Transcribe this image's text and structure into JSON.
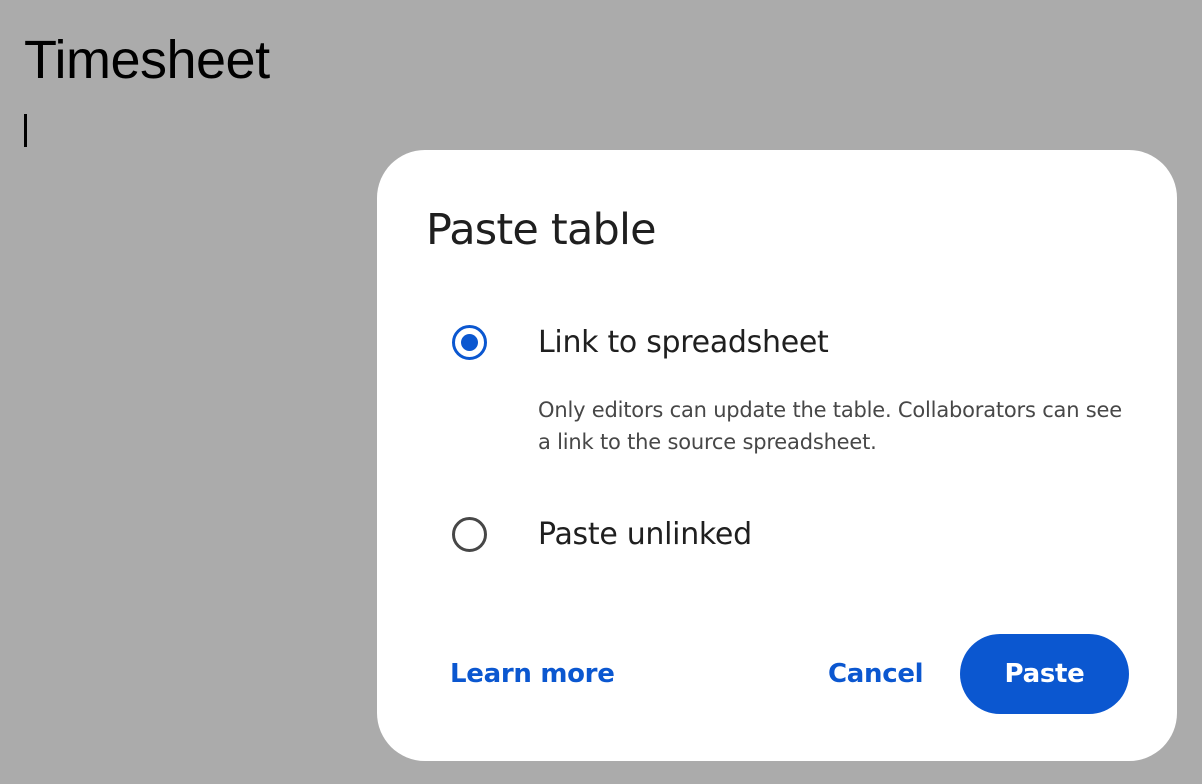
{
  "document": {
    "title": "Timesheet"
  },
  "dialog": {
    "title": "Paste table",
    "options": [
      {
        "label": "Link to spreadsheet",
        "checked": true,
        "description": "Only editors can update the table. Collaborators can see a link to the source spreadsheet."
      },
      {
        "label": "Paste unlinked",
        "checked": false
      }
    ],
    "learn_more_label": "Learn more",
    "cancel_label": "Cancel",
    "paste_label": "Paste"
  },
  "colors": {
    "backdrop": "#ababab",
    "accent": "#0b57d0",
    "dialog_background": "#ffffff",
    "text_primary": "#1f1f1f",
    "text_secondary": "#474747"
  }
}
